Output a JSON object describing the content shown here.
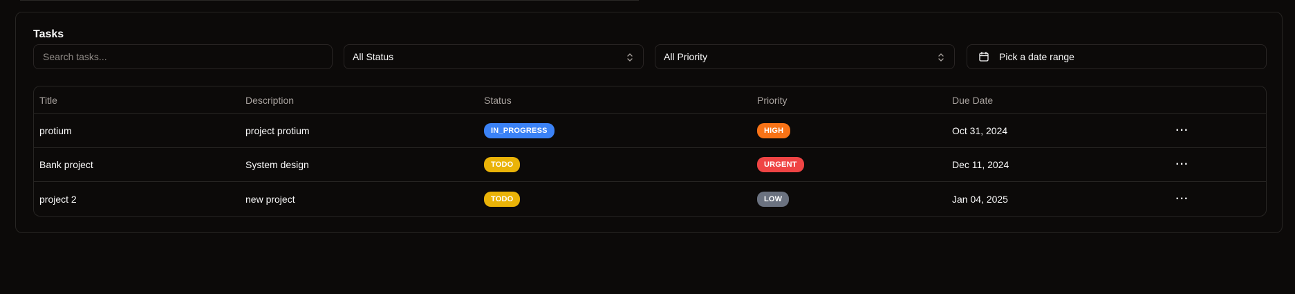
{
  "card": {
    "title": "Tasks"
  },
  "filters": {
    "search_placeholder": "Search tasks...",
    "status_value": "All Status",
    "priority_value": "All Priority",
    "date_range_label": "Pick a date range"
  },
  "table": {
    "headers": {
      "title": "Title",
      "description": "Description",
      "status": "Status",
      "priority": "Priority",
      "due_date": "Due Date"
    },
    "rows": [
      {
        "title": "protium",
        "description": "project protium",
        "status": "IN_PROGRESS",
        "status_color": "#3b82f6",
        "priority": "HIGH",
        "priority_color": "#f97316",
        "due_date": "Oct 31, 2024",
        "actions_icon": "more-horizontal-icon"
      },
      {
        "title": "Bank project",
        "description": "System design",
        "status": "TODO",
        "status_color": "#eab308",
        "priority": "URGENT",
        "priority_color": "#ef4444",
        "due_date": "Dec 11, 2024",
        "actions_icon": "more-horizontal-icon"
      },
      {
        "title": "project 2",
        "description": "new project",
        "status": "TODO",
        "status_color": "#eab308",
        "priority": "LOW",
        "priority_color": "#6b7280",
        "due_date": "Jan 04, 2025",
        "actions_icon": "more-horizontal-icon"
      }
    ]
  }
}
